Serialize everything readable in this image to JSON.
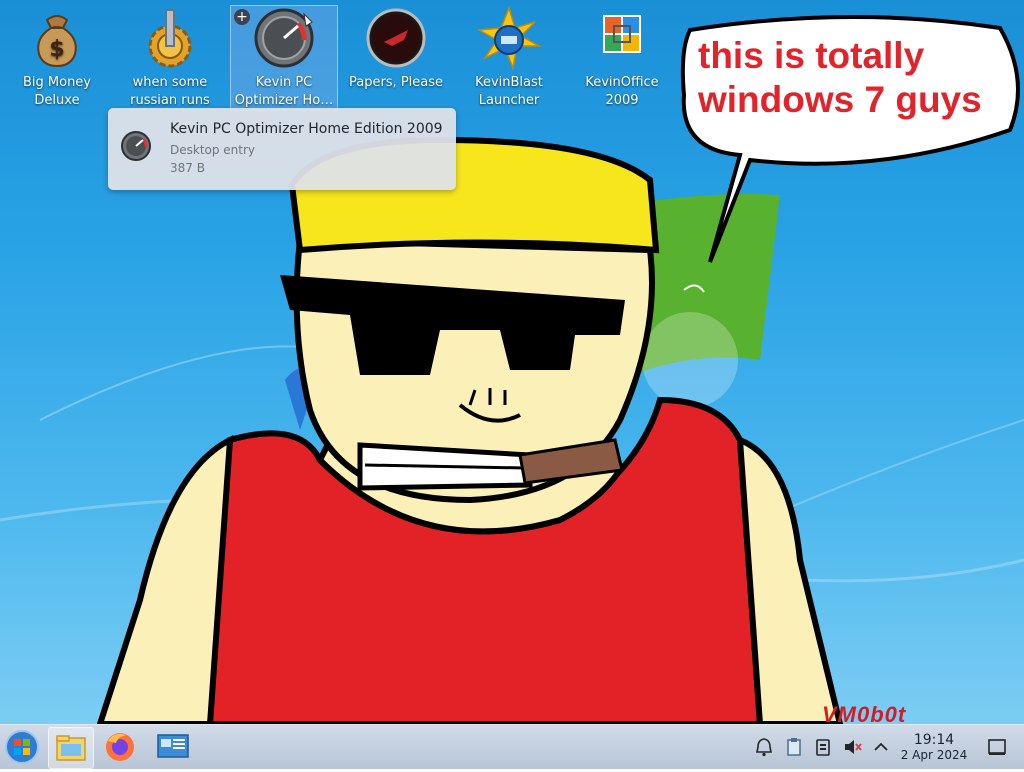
{
  "desktop": {
    "icons": [
      {
        "label": "Big Money Deluxe",
        "icon": "money-bag-icon"
      },
      {
        "label": "when some russian runs a…",
        "icon": "gear-icon"
      },
      {
        "label": "Kevin PC Optimizer Ho…",
        "icon": "speedometer-icon",
        "selected": true
      },
      {
        "label": "Papers, Please",
        "icon": "papers-please-icon"
      },
      {
        "label": "KevinBlast Launcher",
        "icon": "kevinblast-icon"
      },
      {
        "label": "KevinOffice 2009",
        "icon": "kevinoffice-icon"
      }
    ],
    "speech_bubble": "this is totally windows 7 guys",
    "signature": "VM0b0t"
  },
  "tooltip": {
    "title": "Kevin PC Optimizer Home Edition 2009",
    "type": "Desktop entry",
    "size": "387 B"
  },
  "taskbar": {
    "apps": [
      "start-menu-icon",
      "file-manager-icon",
      "firefox-icon",
      "system-settings-icon"
    ],
    "tray": [
      "notifications-bell-icon",
      "clipboard-icon",
      "device-icon",
      "volume-muted-icon",
      "expand-tray-icon"
    ],
    "clock": {
      "time": "19:14",
      "date": "2 Apr 2024"
    }
  },
  "colors": {
    "bubble_text": "#e1242c",
    "taskbar": "#c8d4e2",
    "desktop_blue": "#1a8fd6"
  }
}
